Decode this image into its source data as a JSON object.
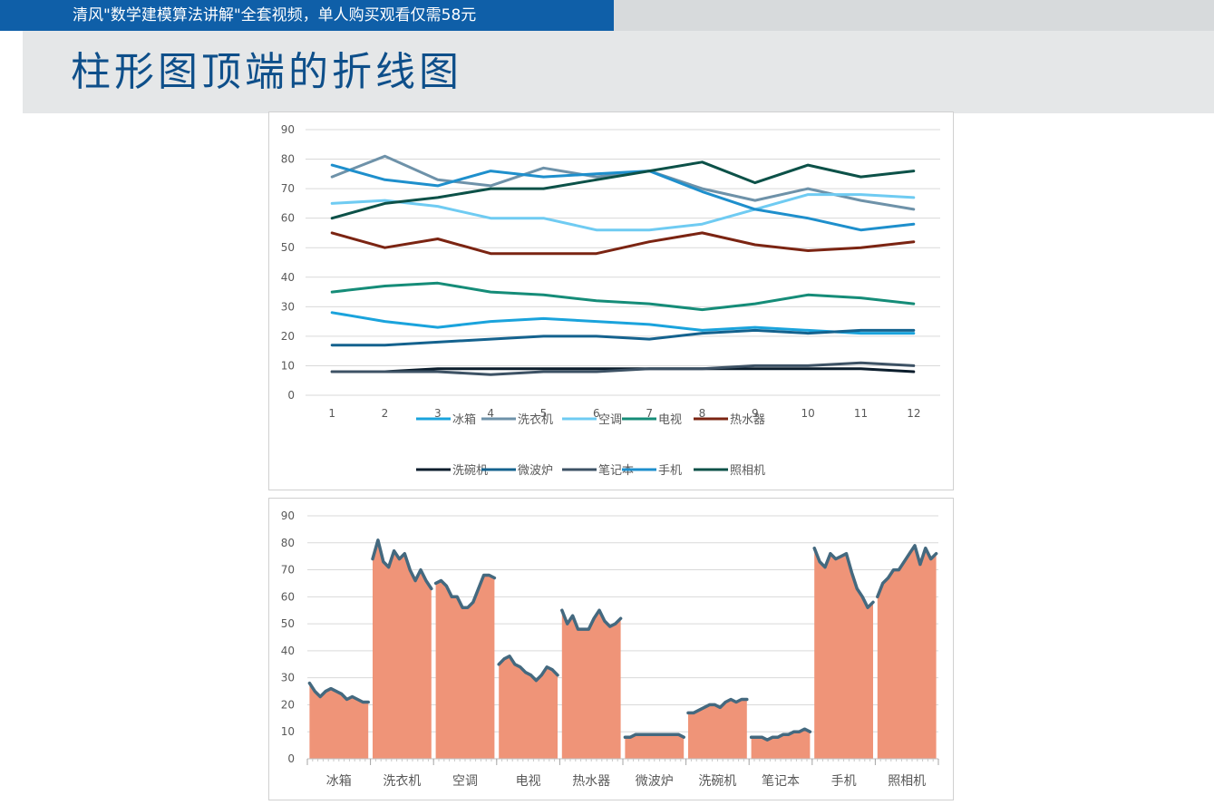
{
  "header": {
    "banner_text": "清风\"数学建模算法讲解\"全套视频，单人购买观看仅需58元",
    "banner_color": "#0f5fa8",
    "title": "柱形图顶端的折线图",
    "title_color": "#0e4f8a"
  },
  "chart_data": [
    {
      "type": "line",
      "x": [
        1,
        2,
        3,
        4,
        5,
        6,
        7,
        8,
        9,
        10,
        11,
        12
      ],
      "ylim": [
        0,
        90
      ],
      "yticks": [
        0,
        10,
        20,
        30,
        40,
        50,
        60,
        70,
        80,
        90
      ],
      "grid": true,
      "legend_position": "bottom",
      "series": [
        {
          "name": "冰箱",
          "color": "#1aa3dc",
          "values": [
            28,
            25,
            23,
            25,
            26,
            25,
            24,
            22,
            23,
            22,
            21,
            21
          ]
        },
        {
          "name": "洗衣机",
          "color": "#6e92a9",
          "values": [
            74,
            81,
            73,
            71,
            77,
            74,
            76,
            70,
            66,
            70,
            66,
            63
          ]
        },
        {
          "name": "空调",
          "color": "#6fcbf2",
          "values": [
            65,
            66,
            64,
            60,
            60,
            56,
            56,
            58,
            63,
            68,
            68,
            67
          ]
        },
        {
          "name": "电视",
          "color": "#158c78",
          "values": [
            35,
            37,
            38,
            35,
            34,
            32,
            31,
            29,
            31,
            34,
            33,
            31
          ]
        },
        {
          "name": "热水器",
          "color": "#7b2412",
          "values": [
            55,
            50,
            53,
            48,
            48,
            48,
            52,
            55,
            51,
            49,
            50,
            52
          ]
        },
        {
          "name": "洗碗机",
          "color": "#0b1d2c",
          "values": [
            8,
            8,
            9,
            9,
            9,
            9,
            9,
            9,
            9,
            9,
            9,
            8
          ]
        },
        {
          "name": "微波炉",
          "color": "#14628e",
          "values": [
            17,
            17,
            18,
            19,
            20,
            20,
            19,
            21,
            22,
            21,
            22,
            22
          ]
        },
        {
          "name": "笔记本",
          "color": "#3d5265",
          "values": [
            8,
            8,
            8,
            7,
            8,
            8,
            9,
            9,
            10,
            10,
            11,
            10
          ]
        },
        {
          "name": "手机",
          "color": "#1e8fcc",
          "values": [
            78,
            73,
            71,
            76,
            74,
            75,
            76,
            69,
            63,
            60,
            56,
            58
          ]
        },
        {
          "name": "照相机",
          "color": "#0c5148",
          "values": [
            60,
            65,
            67,
            70,
            70,
            73,
            76,
            79,
            72,
            78,
            74,
            76
          ]
        }
      ]
    },
    {
      "type": "bar",
      "categories": [
        "冰箱",
        "洗衣机",
        "空调",
        "电视",
        "热水器",
        "微波炉",
        "洗碗机",
        "笔记本",
        "手机",
        "照相机"
      ],
      "ylim": [
        0,
        90
      ],
      "yticks": [
        0,
        10,
        20,
        30,
        40,
        50,
        60,
        70,
        80,
        90
      ],
      "grid": true,
      "area_color": "#ef9478",
      "line_color": "#44697f",
      "series": [
        {
          "values": [
            28,
            25,
            23,
            25,
            26,
            25,
            24,
            22,
            23,
            22,
            21,
            21
          ]
        },
        {
          "values": [
            74,
            81,
            73,
            71,
            77,
            74,
            76,
            70,
            66,
            70,
            66,
            63
          ]
        },
        {
          "values": [
            65,
            66,
            64,
            60,
            60,
            56,
            56,
            58,
            63,
            68,
            68,
            67
          ]
        },
        {
          "values": [
            35,
            37,
            38,
            35,
            34,
            32,
            31,
            29,
            31,
            34,
            33,
            31
          ]
        },
        {
          "values": [
            55,
            50,
            53,
            48,
            48,
            48,
            52,
            55,
            51,
            49,
            50,
            52
          ]
        },
        {
          "values": [
            8,
            8,
            9,
            9,
            9,
            9,
            9,
            9,
            9,
            9,
            9,
            8
          ]
        },
        {
          "values": [
            17,
            17,
            18,
            19,
            20,
            20,
            19,
            21,
            22,
            21,
            22,
            22
          ]
        },
        {
          "values": [
            8,
            8,
            8,
            7,
            8,
            8,
            9,
            9,
            10,
            10,
            11,
            10
          ]
        },
        {
          "values": [
            78,
            73,
            71,
            76,
            74,
            75,
            76,
            69,
            63,
            60,
            56,
            58
          ]
        },
        {
          "values": [
            60,
            65,
            67,
            70,
            70,
            73,
            76,
            79,
            72,
            78,
            74,
            76
          ]
        }
      ]
    }
  ]
}
